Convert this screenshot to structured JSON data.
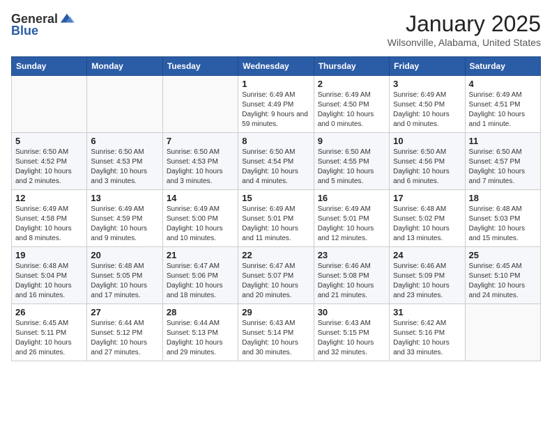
{
  "header": {
    "logo_general": "General",
    "logo_blue": "Blue",
    "month_title": "January 2025",
    "location": "Wilsonville, Alabama, United States"
  },
  "weekdays": [
    "Sunday",
    "Monday",
    "Tuesday",
    "Wednesday",
    "Thursday",
    "Friday",
    "Saturday"
  ],
  "weeks": [
    [
      {
        "day": "",
        "info": ""
      },
      {
        "day": "",
        "info": ""
      },
      {
        "day": "",
        "info": ""
      },
      {
        "day": "1",
        "info": "Sunrise: 6:49 AM\nSunset: 4:49 PM\nDaylight: 9 hours and 59 minutes."
      },
      {
        "day": "2",
        "info": "Sunrise: 6:49 AM\nSunset: 4:50 PM\nDaylight: 10 hours and 0 minutes."
      },
      {
        "day": "3",
        "info": "Sunrise: 6:49 AM\nSunset: 4:50 PM\nDaylight: 10 hours and 0 minutes."
      },
      {
        "day": "4",
        "info": "Sunrise: 6:49 AM\nSunset: 4:51 PM\nDaylight: 10 hours and 1 minute."
      }
    ],
    [
      {
        "day": "5",
        "info": "Sunrise: 6:50 AM\nSunset: 4:52 PM\nDaylight: 10 hours and 2 minutes."
      },
      {
        "day": "6",
        "info": "Sunrise: 6:50 AM\nSunset: 4:53 PM\nDaylight: 10 hours and 3 minutes."
      },
      {
        "day": "7",
        "info": "Sunrise: 6:50 AM\nSunset: 4:53 PM\nDaylight: 10 hours and 3 minutes."
      },
      {
        "day": "8",
        "info": "Sunrise: 6:50 AM\nSunset: 4:54 PM\nDaylight: 10 hours and 4 minutes."
      },
      {
        "day": "9",
        "info": "Sunrise: 6:50 AM\nSunset: 4:55 PM\nDaylight: 10 hours and 5 minutes."
      },
      {
        "day": "10",
        "info": "Sunrise: 6:50 AM\nSunset: 4:56 PM\nDaylight: 10 hours and 6 minutes."
      },
      {
        "day": "11",
        "info": "Sunrise: 6:50 AM\nSunset: 4:57 PM\nDaylight: 10 hours and 7 minutes."
      }
    ],
    [
      {
        "day": "12",
        "info": "Sunrise: 6:49 AM\nSunset: 4:58 PM\nDaylight: 10 hours and 8 minutes."
      },
      {
        "day": "13",
        "info": "Sunrise: 6:49 AM\nSunset: 4:59 PM\nDaylight: 10 hours and 9 minutes."
      },
      {
        "day": "14",
        "info": "Sunrise: 6:49 AM\nSunset: 5:00 PM\nDaylight: 10 hours and 10 minutes."
      },
      {
        "day": "15",
        "info": "Sunrise: 6:49 AM\nSunset: 5:01 PM\nDaylight: 10 hours and 11 minutes."
      },
      {
        "day": "16",
        "info": "Sunrise: 6:49 AM\nSunset: 5:01 PM\nDaylight: 10 hours and 12 minutes."
      },
      {
        "day": "17",
        "info": "Sunrise: 6:48 AM\nSunset: 5:02 PM\nDaylight: 10 hours and 13 minutes."
      },
      {
        "day": "18",
        "info": "Sunrise: 6:48 AM\nSunset: 5:03 PM\nDaylight: 10 hours and 15 minutes."
      }
    ],
    [
      {
        "day": "19",
        "info": "Sunrise: 6:48 AM\nSunset: 5:04 PM\nDaylight: 10 hours and 16 minutes."
      },
      {
        "day": "20",
        "info": "Sunrise: 6:48 AM\nSunset: 5:05 PM\nDaylight: 10 hours and 17 minutes."
      },
      {
        "day": "21",
        "info": "Sunrise: 6:47 AM\nSunset: 5:06 PM\nDaylight: 10 hours and 18 minutes."
      },
      {
        "day": "22",
        "info": "Sunrise: 6:47 AM\nSunset: 5:07 PM\nDaylight: 10 hours and 20 minutes."
      },
      {
        "day": "23",
        "info": "Sunrise: 6:46 AM\nSunset: 5:08 PM\nDaylight: 10 hours and 21 minutes."
      },
      {
        "day": "24",
        "info": "Sunrise: 6:46 AM\nSunset: 5:09 PM\nDaylight: 10 hours and 23 minutes."
      },
      {
        "day": "25",
        "info": "Sunrise: 6:45 AM\nSunset: 5:10 PM\nDaylight: 10 hours and 24 minutes."
      }
    ],
    [
      {
        "day": "26",
        "info": "Sunrise: 6:45 AM\nSunset: 5:11 PM\nDaylight: 10 hours and 26 minutes."
      },
      {
        "day": "27",
        "info": "Sunrise: 6:44 AM\nSunset: 5:12 PM\nDaylight: 10 hours and 27 minutes."
      },
      {
        "day": "28",
        "info": "Sunrise: 6:44 AM\nSunset: 5:13 PM\nDaylight: 10 hours and 29 minutes."
      },
      {
        "day": "29",
        "info": "Sunrise: 6:43 AM\nSunset: 5:14 PM\nDaylight: 10 hours and 30 minutes."
      },
      {
        "day": "30",
        "info": "Sunrise: 6:43 AM\nSunset: 5:15 PM\nDaylight: 10 hours and 32 minutes."
      },
      {
        "day": "31",
        "info": "Sunrise: 6:42 AM\nSunset: 5:16 PM\nDaylight: 10 hours and 33 minutes."
      },
      {
        "day": "",
        "info": ""
      }
    ]
  ]
}
